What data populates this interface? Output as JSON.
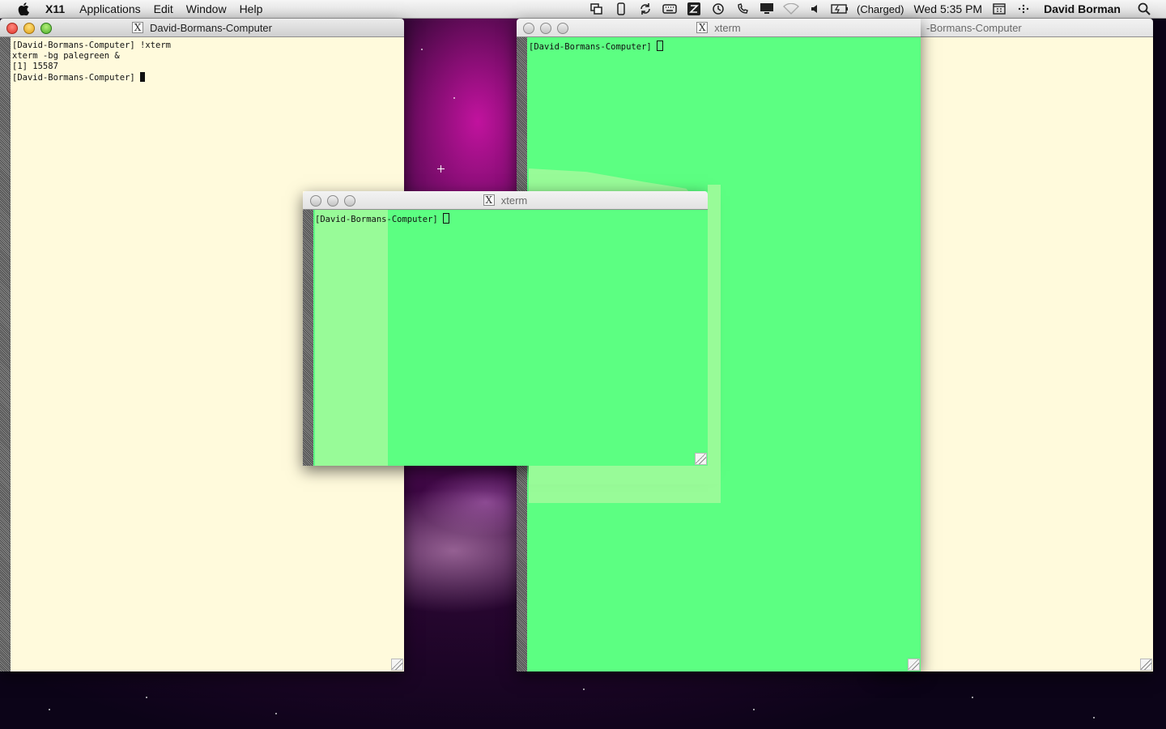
{
  "menubar": {
    "app_name": "X11",
    "items": [
      "Applications",
      "Edit",
      "Window",
      "Help"
    ],
    "battery_status": "(Charged)",
    "clock": "Wed 5:35 PM",
    "user": "David Borman"
  },
  "windows": {
    "left_terminal": {
      "title": "David-Bormans-Computer",
      "bg_color": "#fffadc",
      "lines": [
        "[David-Bormans-Computer] !xterm",
        "xterm -bg palegreen &",
        "[1] 15587",
        "[David-Bormans-Computer] "
      ]
    },
    "right_back_terminal": {
      "title_fragment": "-Bormans-Computer",
      "bg_color": "#fffadc"
    },
    "right_xterm": {
      "title": "xterm",
      "bg_color": "#5cff82",
      "prompt": "[David-Bormans-Computer] "
    },
    "center_xterm": {
      "title": "xterm",
      "bg_color": "#5cff82",
      "ghost_color": "#98fb98",
      "prompt": "[David-Bormans-Computer] "
    }
  }
}
